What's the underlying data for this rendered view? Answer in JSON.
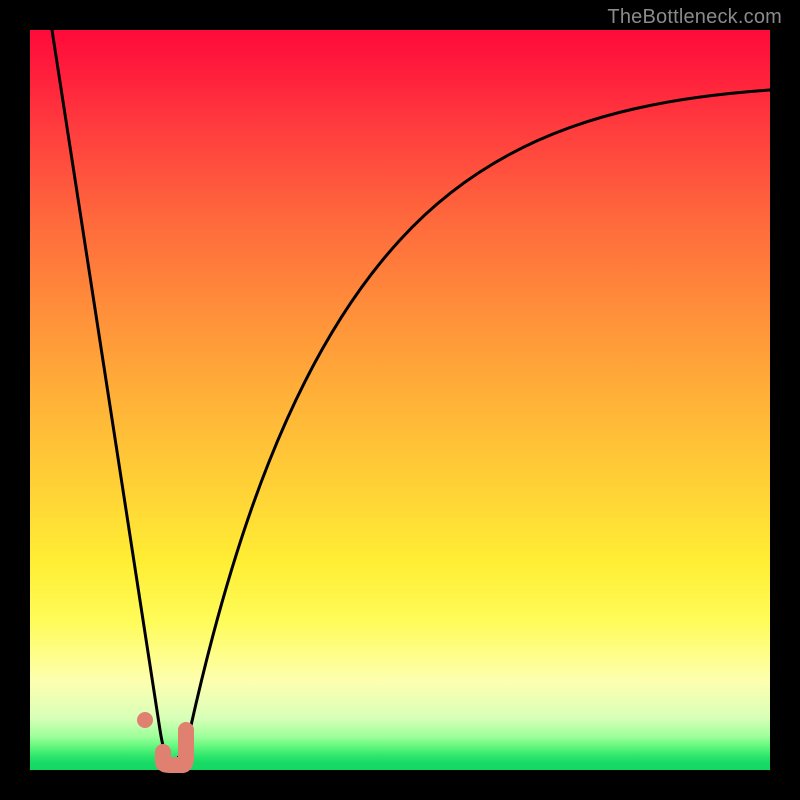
{
  "watermark": "TheBottleneck.com",
  "colors": {
    "gradient_top": "#ff0a3a",
    "gradient_mid": "#ffd236",
    "gradient_bottom": "#13d864",
    "curve": "#000000",
    "marker": "#e08070",
    "frame": "#000000"
  },
  "chart_data": {
    "type": "line",
    "title": "",
    "xlabel": "",
    "ylabel": "",
    "xlim": [
      0,
      100
    ],
    "ylim": [
      0,
      100
    ],
    "grid": false,
    "series": [
      {
        "name": "bottleneck-curve",
        "x": [
          3,
          6,
          9,
          12,
          14,
          16,
          18,
          20,
          22,
          24,
          27,
          30,
          34,
          38,
          43,
          48,
          54,
          60,
          67,
          74,
          82,
          90,
          100
        ],
        "values": [
          100,
          80,
          60,
          40,
          24,
          10,
          3,
          2,
          3,
          10,
          25,
          40,
          53,
          63,
          71,
          77,
          81,
          84,
          86.5,
          88,
          89.2,
          90,
          91
        ]
      }
    ],
    "annotations": [
      {
        "name": "optimal-range-marker",
        "x_start": 15.5,
        "x_end": 20,
        "y_start": 6,
        "y_end": 0
      },
      {
        "name": "optimal-start-dot",
        "x": 14.5,
        "y": 8
      }
    ]
  }
}
